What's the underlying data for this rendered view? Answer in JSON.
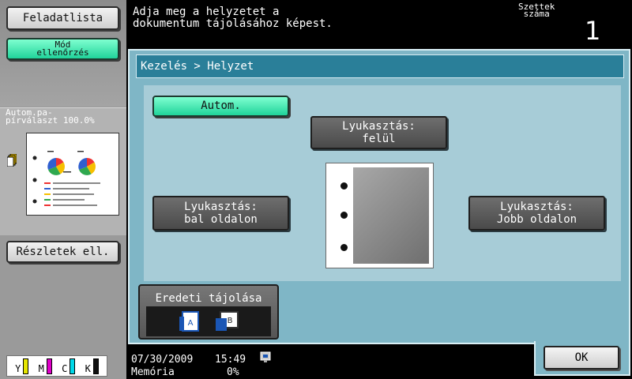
{
  "left": {
    "job_list_label": "Feladatlista",
    "mode_check_label": "Mód\nellenőrzés",
    "preview_label": "Autom.pa-\npírválaszt 100.0%",
    "details_label": "Részletek ell.",
    "toner": [
      {
        "letter": "Y",
        "color": "#e6e600"
      },
      {
        "letter": "M",
        "color": "#e000c8"
      },
      {
        "letter": "C",
        "color": "#00d8e8"
      },
      {
        "letter": "K",
        "color": "#111111"
      }
    ]
  },
  "top": {
    "message": "Adja meg a helyzetet a\ndokumentum tájolásához képest.",
    "copies_label": "Szettek\nszáma",
    "copies_value": "1"
  },
  "main": {
    "breadcrumb": "Kezelés > Helyzet",
    "auto_label": "Autom.",
    "top_label": "Lyukasztás:\nfelül",
    "left_label": "Lyukasztás:\nbal oldalon",
    "right_label": "Lyukasztás:\nJobb oldalon",
    "orientation_label": "Eredeti tájolása",
    "ok_label": "OK"
  },
  "status": {
    "date": "07/30/2009",
    "time": "15:49",
    "memory_label": "Memória",
    "memory_value": "0%"
  },
  "colors": {
    "panel_bg": "#7fb6c6",
    "breadcrumb_bg": "#2a7f99",
    "accent_green": "#20d39a"
  }
}
